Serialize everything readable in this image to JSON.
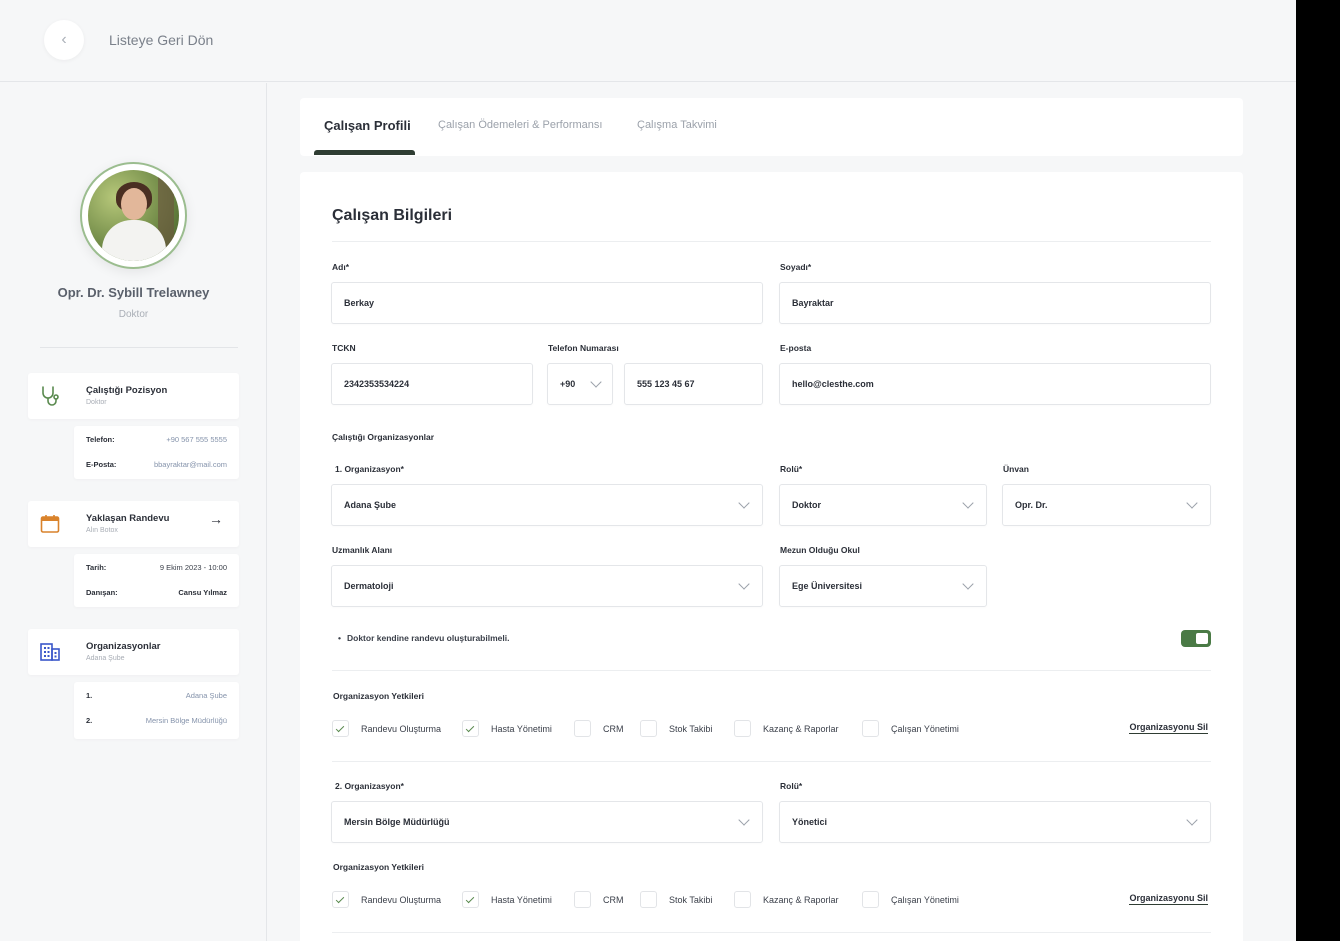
{
  "topbar": {
    "back_label": "Listeye Geri Dön",
    "back_icon": "chevron-left-icon"
  },
  "profile": {
    "name": "Opr. Dr. Sybill Trelawney",
    "role": "Doktor"
  },
  "position_card": {
    "title": "Çalıştığı Pozisyon",
    "subtitle": "Doktor",
    "icon": "stethoscope-icon",
    "rows": [
      {
        "key": "Telefon:",
        "value": "+90 567 555 5555"
      },
      {
        "key": "E-Posta:",
        "value": "bbayraktar@mail.com"
      }
    ]
  },
  "appointment_card": {
    "title": "Yaklaşan Randevu",
    "subtitle": "Alın Botox",
    "icon": "calendar-icon",
    "arrow": "→",
    "rows": [
      {
        "key": "Tarih:",
        "value": "9 Ekim 2023 - 10:00"
      },
      {
        "key": "Danışan:",
        "value": "Cansu Yılmaz"
      }
    ]
  },
  "org_card": {
    "title": "Organizasyonlar",
    "subtitle": "Adana Şube",
    "icon": "building-icon",
    "rows": [
      {
        "key": "1.",
        "value": "Adana Şube"
      },
      {
        "key": "2.",
        "value": "Mersin Bölge Müdürlüğü"
      }
    ]
  },
  "tabs": [
    {
      "label": "Çalışan Profili",
      "active": true
    },
    {
      "label": "Çalışan Ödemeleri & Performansı",
      "active": false
    },
    {
      "label": "Çalışma Takvimi",
      "active": false
    }
  ],
  "form": {
    "title": "Çalışan Bilgileri",
    "first_name": {
      "label": "Adı*",
      "value": "Berkay"
    },
    "last_name": {
      "label": "Soyadı*",
      "value": "Bayraktar"
    },
    "tckn": {
      "label": "TCKN",
      "value": "2342353534224"
    },
    "phone": {
      "label": "Telefon Numarası",
      "code": "+90",
      "value": "555 123 45 67"
    },
    "email": {
      "label": "E-posta",
      "value": "hello@clesthe.com"
    },
    "orgs_label": "Çalıştığı Organizasyonlar",
    "org1": {
      "label": "1. Organizasyon*",
      "value": "Adana Şube"
    },
    "role1": {
      "label": "Rolü*",
      "value": "Doktor"
    },
    "title1": {
      "label": "Ünvan",
      "value": "Opr. Dr."
    },
    "specialty": {
      "label": "Uzmanlık Alanı",
      "value": "Dermatoloji"
    },
    "school": {
      "label": "Mezun Olduğu Okul",
      "value": "Ege Üniversitesi"
    },
    "self_appointment_note": "Doktor kendine randevu oluşturabilmeli.",
    "self_appointment_enabled": true,
    "permissions_label": "Organizasyon Yetkileri",
    "permissions1": [
      {
        "label": "Randevu Oluşturma",
        "checked": true
      },
      {
        "label": "Hasta Yönetimi",
        "checked": true
      },
      {
        "label": "CRM",
        "checked": false
      },
      {
        "label": "Stok Takibi",
        "checked": false
      },
      {
        "label": "Kazanç & Raporlar",
        "checked": false
      },
      {
        "label": "Çalışan Yönetimi",
        "checked": false
      }
    ],
    "delete_org_label": "Organizasyonu Sil",
    "org2": {
      "label": "2. Organizasyon*",
      "value": "Mersin Bölge Müdürlüğü"
    },
    "role2": {
      "label": "Rolü*",
      "value": "Yönetici"
    },
    "permissions2": [
      {
        "label": "Randevu Oluşturma",
        "checked": true
      },
      {
        "label": "Hasta Yönetimi",
        "checked": true
      },
      {
        "label": "CRM",
        "checked": false
      },
      {
        "label": "Stok Takibi",
        "checked": false
      },
      {
        "label": "Kazanç & Raporlar",
        "checked": false
      },
      {
        "label": "Çalışan Yönetimi",
        "checked": false
      }
    ]
  },
  "colors": {
    "accent": "#4a7a45",
    "tab_underline": "#2f3d33",
    "org_icon": "#3a56c9",
    "calendar_icon": "#d9822b"
  }
}
